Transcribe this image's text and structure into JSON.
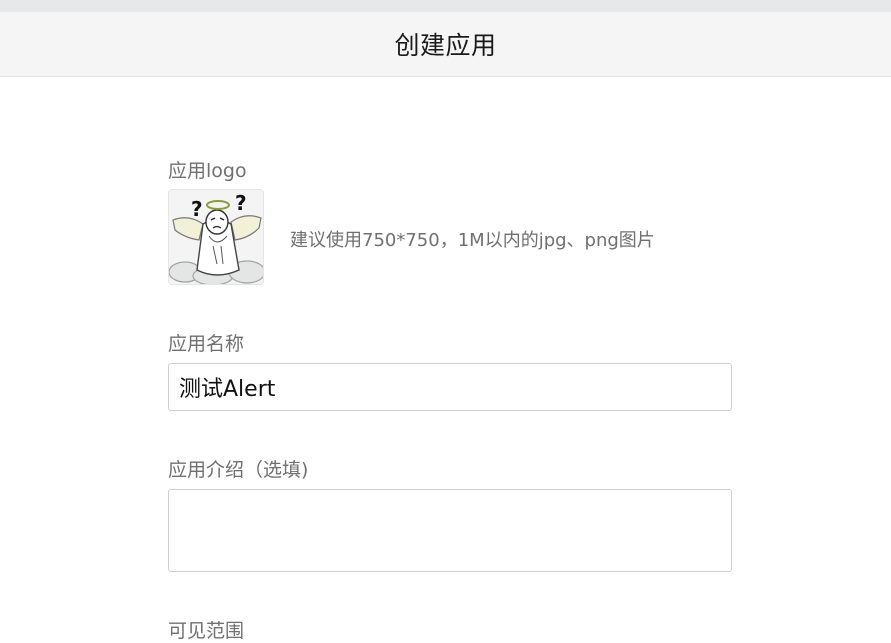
{
  "header": {
    "title": "创建应用"
  },
  "form": {
    "logo": {
      "label": "应用logo",
      "hint": "建议使用750*750，1M以内的jpg、png图片",
      "image_description": "cartoon-angel-question-marks"
    },
    "name": {
      "label": "应用名称",
      "value": "测试Alert"
    },
    "description": {
      "label": "应用介绍（选填)",
      "value": ""
    },
    "visibility": {
      "label": "可见范围"
    }
  },
  "colors": {
    "header_bg": "#f5f5f5",
    "label_text": "#707070",
    "input_border": "#cfcfcf"
  }
}
